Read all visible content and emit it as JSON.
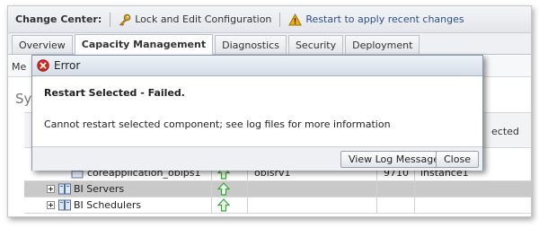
{
  "change_center": {
    "title": "Change Center:",
    "lock_label": "Lock and Edit Configuration",
    "restart_label": "Restart to apply recent changes"
  },
  "tabs": [
    {
      "label": "Overview",
      "active": false
    },
    {
      "label": "Capacity Management",
      "active": true
    },
    {
      "label": "Diagnostics",
      "active": false
    },
    {
      "label": "Security",
      "active": false
    },
    {
      "label": "Deployment",
      "active": false
    }
  ],
  "subbar": {
    "text": "Me"
  },
  "section": {
    "title": "Sy"
  },
  "table": {
    "header_partial": "ected",
    "rows": [
      {
        "name": "coreapplication_obips1",
        "status": "up",
        "server": "obisrv1",
        "port": "9710",
        "instance": "instance1",
        "expandable": false
      },
      {
        "name": "BI Servers",
        "status": "up",
        "server": "",
        "port": "",
        "instance": "",
        "expandable": true
      },
      {
        "name": "BI Schedulers",
        "status": "up",
        "server": "",
        "port": "",
        "instance": "",
        "expandable": true
      }
    ]
  },
  "dialog": {
    "title": "Error",
    "heading": "Restart Selected - Failed.",
    "message": "Cannot restart selected component; see log files for more information",
    "view_log_button": "View Log Messages",
    "close_button": "Close"
  },
  "colors": {
    "link": "#2b4f8c",
    "error_icon": "#d8261f",
    "warning_icon": "#f0b400",
    "status_up": "#3aa53a"
  }
}
